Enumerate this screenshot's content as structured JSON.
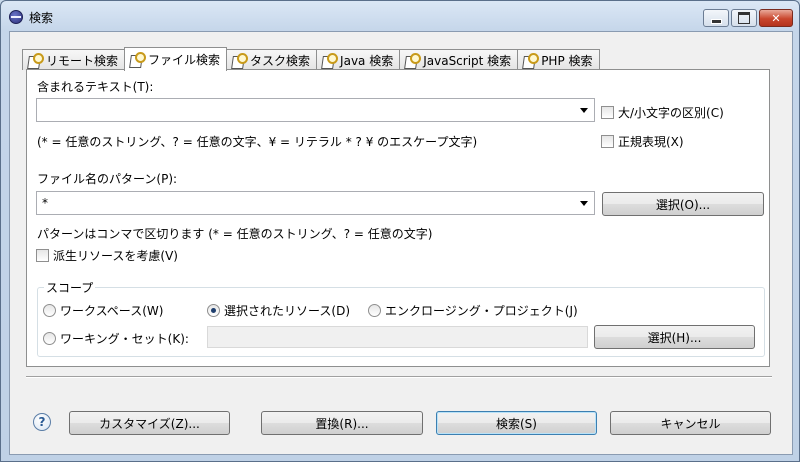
{
  "window": {
    "title": "検索"
  },
  "tabs": [
    {
      "label": "リモート検索"
    },
    {
      "label": "ファイル検索",
      "active": true
    },
    {
      "label": "タスク検索"
    },
    {
      "label": "Java 検索"
    },
    {
      "label": "JavaScript 検索"
    },
    {
      "label": "PHP 検索"
    }
  ],
  "file_search": {
    "contain_text_label": "含まれるテキスト(T):",
    "contain_text_value": "",
    "case_sensitive_label": "大/小文字の区別(C)",
    "regex_hint": "(* = 任意のストリング、? = 任意の文字、¥ = リテラル * ? ¥ のエスケープ文字)",
    "regex_label": "正規表現(X)",
    "pattern_label": "ファイル名のパターン(P):",
    "pattern_value": "*",
    "choose_button": "選択(O)...",
    "pattern_hint": "パターンはコンマで区切ります (* = 任意のストリング、? = 任意の文字)",
    "derived_label": "派生リソースを考慮(V)"
  },
  "scope": {
    "title": "スコープ",
    "workspace_label": "ワークスペース(W)",
    "selected_label": "選択されたリソース(D)",
    "enclosing_label": "エンクロージング・プロジェクト(J)",
    "working_set_label": "ワーキング・セット(K):",
    "working_set_value": "",
    "choose_button": "選択(H)...",
    "selected_option": "選択されたリソース(D)"
  },
  "footer": {
    "customize_button": "カスタマイズ(Z)...",
    "replace_button": "置換(R)...",
    "search_button": "検索(S)",
    "cancel_button": "キャンセル"
  }
}
